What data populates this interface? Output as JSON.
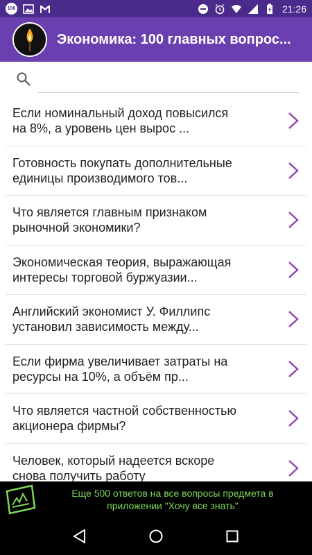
{
  "status_bar": {
    "badge": "100",
    "time": "21:26",
    "icons": [
      "notification-100-icon",
      "image-icon",
      "gmail-icon",
      "do-not-disturb-icon",
      "alarm-icon",
      "wifi-icon",
      "signal-icon",
      "battery-charging-icon"
    ]
  },
  "app_bar": {
    "title": "Экономика: 100 главных вопрос...",
    "logo_icon": "candle-flame-icon"
  },
  "search": {
    "placeholder": "",
    "value": ""
  },
  "questions": [
    {
      "line1": "Если номинальный доход повысился",
      "line2": "на 8%, а уровень цен вырос ..."
    },
    {
      "line1": "Готовность покупать дополнительные",
      "line2": "единицы производимого тов..."
    },
    {
      "line1": "Что является главным признаком",
      "line2": "рыночной экономики?"
    },
    {
      "line1": "Экономическая теория, выражающая",
      "line2": "интересы торговой буржуазии..."
    },
    {
      "line1": "Английский экономист У. Филлипс",
      "line2": "установил зависимость между..."
    },
    {
      "line1": "Если фирма увеличивает затраты на",
      "line2": "ресурсы на 10%, а объём пр..."
    },
    {
      "line1": "Что является частной собственностью",
      "line2": "акционера фирмы?"
    },
    {
      "line1": "Человек, который надеется вскоре",
      "line2": "снова получить работу"
    }
  ],
  "ad": {
    "line1": "Еще 500 ответов на все вопросы предмета в",
    "line2": "приложении \"Хочу все знать\""
  },
  "colors": {
    "status_bar": "#4a2a8a",
    "app_bar": "#6a3fb0",
    "chevron": "#8e44ad",
    "ad_text": "#7ed957"
  },
  "nav": [
    "back-icon",
    "home-icon",
    "recents-icon"
  ]
}
